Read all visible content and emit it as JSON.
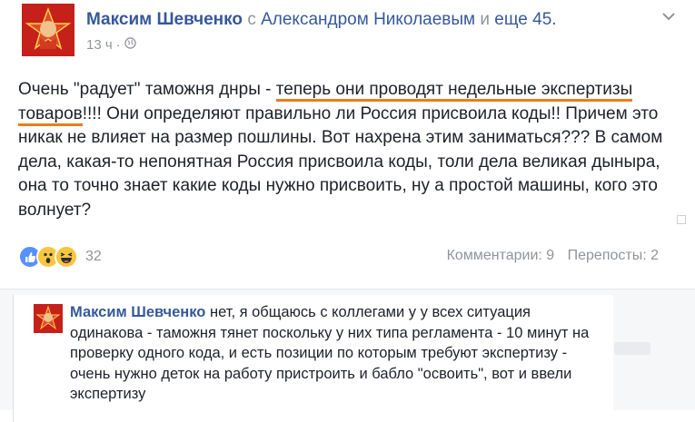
{
  "post": {
    "author": "Максим Шевченко",
    "connector": "с",
    "tagged": "Александром Николаевым",
    "and_word": "и",
    "others": "еще 45.",
    "time": "13 ч",
    "text_part1": "Очень \"радует\" таможня днры - ",
    "text_underlined": "теперь они проводят недельные экспертизы товаров",
    "text_part2": "!!!! Они определяют правильно ли Россия присвоила коды!! Причем это никак не влияет на размер пошлины. Вот нахрена этим заниматься??? В самом дела, какая-то непонятная Россия присвоила коды, толи дела великая дыныра, она то точно знает какие коды нужно присвоить, ну а простой машины, кого это волнует?",
    "reaction_count": "32",
    "comments_count": "Комментарии: 9",
    "shares_count": "Перепосты: 2"
  },
  "comment": {
    "author": "Максим Шевченко",
    "text": " нет, я общаюсь с коллегами у у всех ситуация одинакова - таможня тянет поскольку у них типа регламента - 10 минут на проверку одного кода, и есть позиции по которым требуют экспертизу - очень нужно деток на работу пристроить и бабло \"освоить\", вот и ввели экспертизу"
  },
  "colors": {
    "link": "#365899",
    "meta": "#90949c",
    "underline": "#f07b1c",
    "avatar_bg": "#c6201a"
  },
  "icons": [
    "globe-icon",
    "chevron-down-icon",
    "like-reaction-icon",
    "wow-reaction-icon",
    "haha-reaction-icon"
  ]
}
